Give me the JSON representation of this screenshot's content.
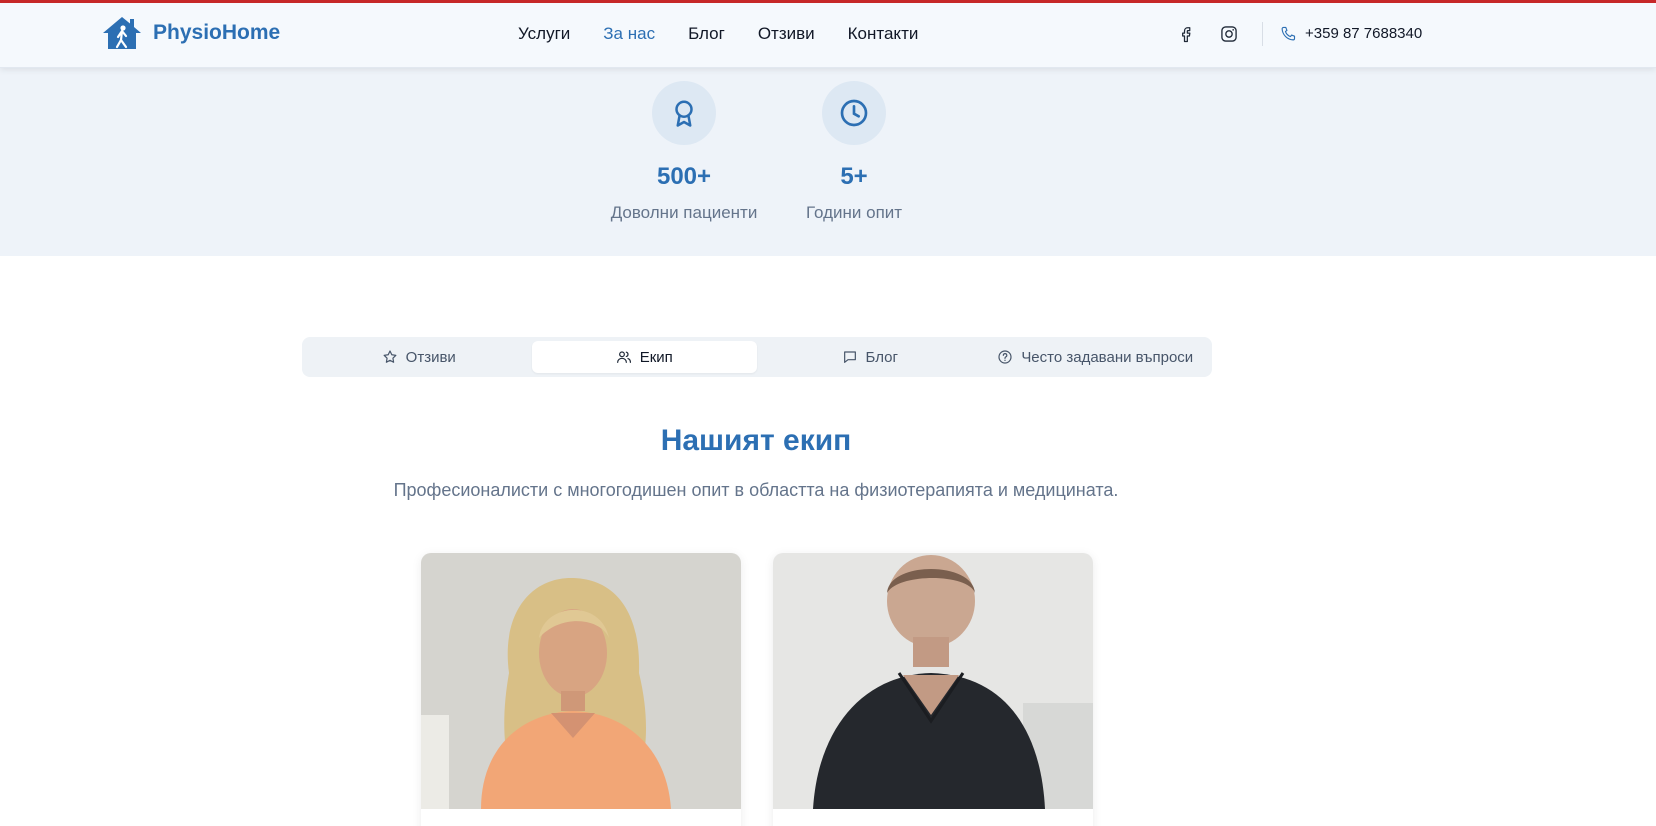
{
  "header": {
    "logo_text": "PhysioHome",
    "nav": [
      {
        "label": "Услуги",
        "active": false
      },
      {
        "label": "За нас",
        "active": true
      },
      {
        "label": "Блог",
        "active": false
      },
      {
        "label": "Отзиви",
        "active": false
      },
      {
        "label": "Контакти",
        "active": false
      }
    ],
    "social_icons": [
      "facebook-icon",
      "instagram-icon"
    ],
    "phone": "+359 87 7688340"
  },
  "stats": [
    {
      "icon": "award-icon",
      "value": "500+",
      "label": "Доволни пациенти"
    },
    {
      "icon": "clock-icon",
      "value": "5+",
      "label": "Години опит"
    }
  ],
  "tabs": [
    {
      "icon": "star-icon",
      "label": "Отзиви",
      "active": false
    },
    {
      "icon": "users-icon",
      "label": "Екип",
      "active": true
    },
    {
      "icon": "message-icon",
      "label": "Блог",
      "active": false
    },
    {
      "icon": "help-circle-icon",
      "label": "Често задавани въпроси",
      "active": false
    }
  ],
  "team_section": {
    "title": "Нашият екип",
    "subtitle": "Професионалисти с многогодишен опит в областта на физиотерапията и медицината."
  },
  "colors": {
    "brand": "#2c6fb3",
    "stats_band": "#eef3f9",
    "top_accent": "#c62828"
  }
}
